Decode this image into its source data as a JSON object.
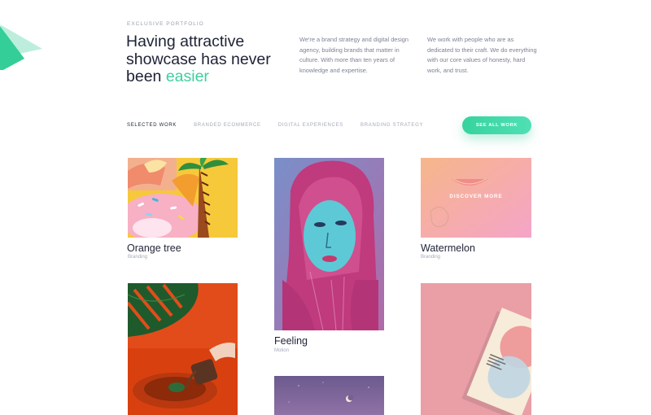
{
  "hero": {
    "eyebrow": "EXCLUSIVE PORTFOLIO",
    "headline_main": "Having attractive showcase has never been",
    "headline_accent": "easier",
    "intro_left": "We're a brand strategy and digital design agency, building brands that matter in culture. With more than ten years of knowledge and expertise.",
    "intro_right": "We work with people who are as dedicated to their craft. We do everything with our core values of honesty, hard work, and trust."
  },
  "filters": {
    "items": [
      "SELECTED WORK",
      "BRANDED ECOMMERCE",
      "DIGITAL EXPERIENCES",
      "BRANDING STRATEGY"
    ],
    "active": "SELECTED WORK"
  },
  "see_all_label": "SEE ALL WORK",
  "works": [
    {
      "title": "Orange tree",
      "category": "Branding",
      "image_icon": "donut-palm-image"
    },
    {
      "title": "Feeling",
      "category": "Motion",
      "image_icon": "portrait-image"
    },
    {
      "title": "Watermelon",
      "category": "Branding",
      "image_icon": "watermelon-image",
      "overlay_label": "DISCOVER MORE"
    },
    {
      "title": "",
      "category": "",
      "image_icon": "monstera-teapot-image"
    },
    {
      "title": "",
      "category": "",
      "image_icon": "moon-sky-image"
    },
    {
      "title": "",
      "category": "",
      "image_icon": "brochure-image"
    }
  ],
  "colors": {
    "accent": "#3ecf9e",
    "text_dark": "#1e2235",
    "text_muted": "#7c8294",
    "text_light": "#a4aab7"
  }
}
